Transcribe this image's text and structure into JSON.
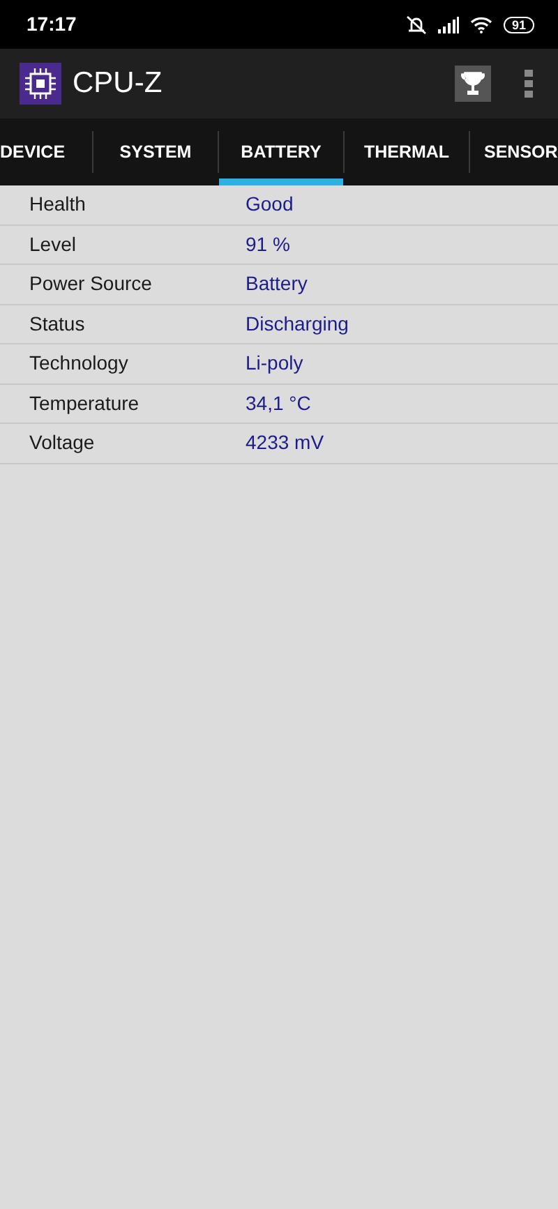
{
  "status_bar": {
    "time": "17:17",
    "battery": "91"
  },
  "app_bar": {
    "title": "CPU-Z"
  },
  "tabs": [
    {
      "label": "DEVICE",
      "selected": false
    },
    {
      "label": "SYSTEM",
      "selected": false
    },
    {
      "label": "BATTERY",
      "selected": true
    },
    {
      "label": "THERMAL",
      "selected": false
    },
    {
      "label": "SENSOR",
      "selected": false
    }
  ],
  "rows": [
    {
      "label": "Health",
      "value": "Good"
    },
    {
      "label": "Level",
      "value": "91 %"
    },
    {
      "label": "Power Source",
      "value": "Battery"
    },
    {
      "label": "Status",
      "value": "Discharging"
    },
    {
      "label": "Technology",
      "value": "Li-poly"
    },
    {
      "label": "Temperature",
      "value": "34,1 °C"
    },
    {
      "label": "Voltage",
      "value": "4233 mV"
    }
  ]
}
